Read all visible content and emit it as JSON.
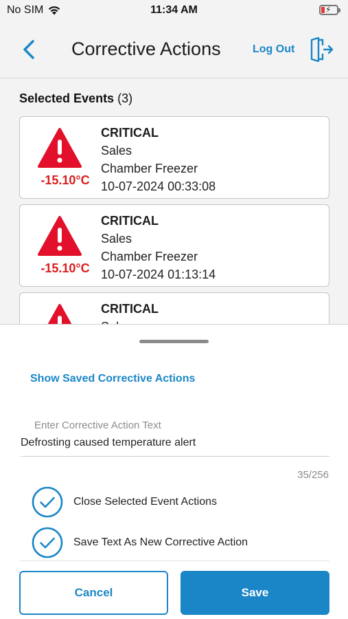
{
  "status_bar": {
    "carrier": "No SIM",
    "time": "11:34 AM"
  },
  "header": {
    "title": "Corrective Actions",
    "logout_label": "Log Out"
  },
  "events": {
    "heading": "Selected Events",
    "count": "(3)",
    "items": [
      {
        "severity": "CRITICAL",
        "location": "Sales",
        "device": "Chamber Freezer",
        "datetime": "10-07-2024 00:33:08",
        "temperature": "-15.10°C"
      },
      {
        "severity": "CRITICAL",
        "location": "Sales",
        "device": "Chamber Freezer",
        "datetime": "10-07-2024 01:13:14",
        "temperature": "-15.10°C"
      },
      {
        "severity": "CRITICAL",
        "location": "Sales",
        "device": "",
        "datetime": "",
        "temperature": ""
      }
    ]
  },
  "sheet": {
    "show_saved_label": "Show Saved Corrective Actions",
    "input_label": "Enter Corrective Action Text",
    "input_value": "Defrosting caused temperature alert",
    "counter": "35/256",
    "options": [
      {
        "label": "Close Selected Event Actions",
        "checked": true
      },
      {
        "label": "Save Text As New Corrective Action",
        "checked": true
      }
    ],
    "cancel_label": "Cancel",
    "save_label": "Save"
  },
  "colors": {
    "accent": "#1a86c7",
    "critical": "#e2102b",
    "temperature": "#d91d1d"
  },
  "icons": {
    "back": "chevron-left-icon",
    "logout": "logout-door-icon",
    "warning": "warning-triangle-icon",
    "check": "check-circle-icon",
    "wifi": "wifi-icon",
    "battery": "battery-charging-icon"
  }
}
